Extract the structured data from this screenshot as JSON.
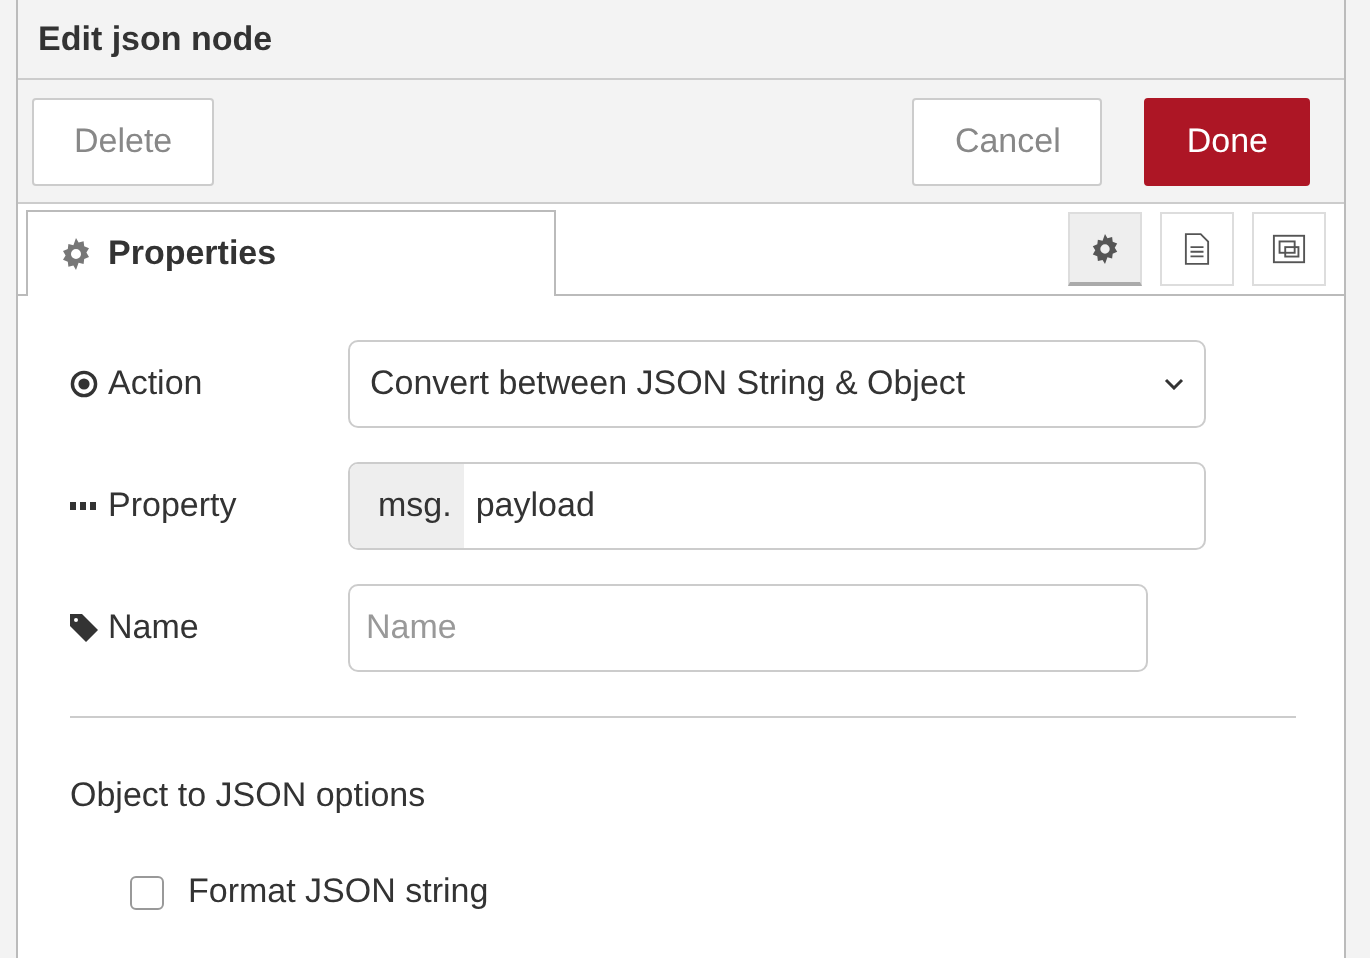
{
  "window": {
    "title": "Edit json node"
  },
  "buttons": [
    {
      "label": "Delete",
      "kind": "plain"
    },
    {
      "label": "Cancel",
      "kind": "plain"
    },
    {
      "label": "Done",
      "kind": "primary"
    }
  ],
  "tabs": [
    {
      "label": "Properties",
      "selected": true
    }
  ],
  "icon_tabs": [
    {
      "kind": "gear",
      "selected": true
    },
    {
      "kind": "document",
      "selected": false
    },
    {
      "kind": "frames",
      "selected": false
    }
  ],
  "fields": [
    {
      "kind": "select",
      "label": "Action",
      "value": "Convert between JSON String & Object"
    },
    {
      "kind": "typed",
      "label": "Property",
      "prefix": "msg.",
      "value": "payload"
    },
    {
      "kind": "text",
      "label": "Name",
      "placeholder": "Name"
    }
  ],
  "section": {
    "title": "Object to JSON options"
  },
  "options": [
    {
      "label": "Format JSON string",
      "checked": false
    }
  ]
}
